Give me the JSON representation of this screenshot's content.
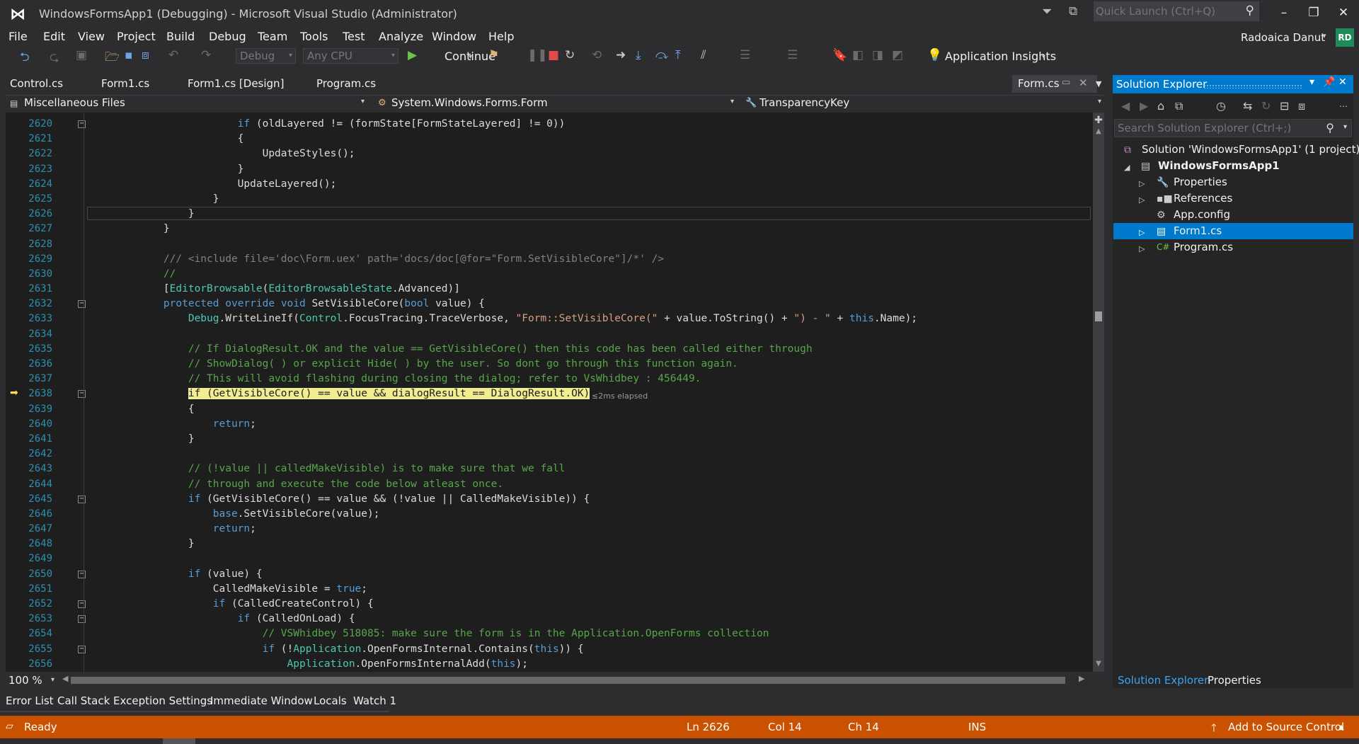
{
  "window": {
    "title": "WindowsFormsApp1 (Debugging) - Microsoft Visual Studio  (Administrator)",
    "quick_launch_placeholder": "Quick Launch (Ctrl+Q)"
  },
  "menu": [
    "File",
    "Edit",
    "View",
    "Project",
    "Build",
    "Debug",
    "Team",
    "Tools",
    "Test",
    "Analyze",
    "Window",
    "Help"
  ],
  "user": {
    "name": "Radoaica Danut",
    "initials": "RD"
  },
  "toolbar": {
    "config": "Debug",
    "platform": "Any CPU",
    "continue": "Continue",
    "app_insights": "Application Insights"
  },
  "doc_tabs": [
    "Control.cs",
    "Form1.cs",
    "Form1.cs [Design]",
    "Program.cs"
  ],
  "active_tab": "Form.cs",
  "navbar": {
    "project": "Miscellaneous Files",
    "type": "System.Windows.Forms.Form",
    "member": "TransparencyKey"
  },
  "editor": {
    "zoom": "100 %",
    "current_line": 2626,
    "execution_line": 2638,
    "elapsed": "≤2ms elapsed",
    "lines": [
      {
        "n": "2620",
        "c": "                if (oldLayered != (formState[FormStateLayered] != 0))"
      },
      {
        "n": "2621",
        "c": "                {"
      },
      {
        "n": "2622",
        "c": "                    UpdateStyles();"
      },
      {
        "n": "2623",
        "c": "                }"
      },
      {
        "n": "2624",
        "c": "                UpdateLayered();"
      },
      {
        "n": "2625",
        "c": "            }"
      },
      {
        "n": "2626",
        "c": "        }"
      },
      {
        "n": "2627",
        "c": "    }"
      },
      {
        "n": "2628",
        "c": ""
      },
      {
        "n": "2629",
        "c": "    /// <include file='doc\\Form.uex' path='docs/doc[@for=\"Form.SetVisibleCore\"]/*' />"
      },
      {
        "n": "2630",
        "c": "    //"
      },
      {
        "n": "2631",
        "c": "    [EditorBrowsable(EditorBrowsableState.Advanced)]"
      },
      {
        "n": "2632",
        "c": "    protected override void SetVisibleCore(bool value) {"
      },
      {
        "n": "2633",
        "c": "        Debug.WriteLineIf(Control.FocusTracing.TraceVerbose, \"Form::SetVisibleCore(\" + value.ToString() + \") - \" + this.Name);"
      },
      {
        "n": "2634",
        "c": ""
      },
      {
        "n": "2635",
        "c": "        // If DialogResult.OK and the value == GetVisibleCore() then this code has been called either through"
      },
      {
        "n": "2636",
        "c": "        // ShowDialog( ) or explicit Hide( ) by the user. So dont go through this function again."
      },
      {
        "n": "2637",
        "c": "        // This will avoid flashing during closing the dialog; refer to VsWhidbey : 456449."
      },
      {
        "n": "2638",
        "c": "        if (GetVisibleCore() == value && dialogResult == DialogResult.OK)"
      },
      {
        "n": "2639",
        "c": "        {"
      },
      {
        "n": "2640",
        "c": "            return;"
      },
      {
        "n": "2641",
        "c": "        }"
      },
      {
        "n": "2642",
        "c": ""
      },
      {
        "n": "2643",
        "c": "        // (!value || calledMakeVisible) is to make sure that we fall"
      },
      {
        "n": "2644",
        "c": "        // through and execute the code below atleast once."
      },
      {
        "n": "2645",
        "c": "        if (GetVisibleCore() == value && (!value || CalledMakeVisible)) {"
      },
      {
        "n": "2646",
        "c": "            base.SetVisibleCore(value);"
      },
      {
        "n": "2647",
        "c": "            return;"
      },
      {
        "n": "2648",
        "c": "        }"
      },
      {
        "n": "2649",
        "c": ""
      },
      {
        "n": "2650",
        "c": "        if (value) {"
      },
      {
        "n": "2651",
        "c": "            CalledMakeVisible = true;"
      },
      {
        "n": "2652",
        "c": "            if (CalledCreateControl) {"
      },
      {
        "n": "2653",
        "c": "                if (CalledOnLoad) {"
      },
      {
        "n": "2654",
        "c": "                    // VSWhidbey 518085: make sure the form is in the Application.OpenForms collection"
      },
      {
        "n": "2655",
        "c": "                    if (!Application.OpenFormsInternal.Contains(this)) {"
      },
      {
        "n": "2656",
        "c": "                        Application.OpenFormsInternalAdd(this);"
      }
    ]
  },
  "bottom_tabs": [
    "Error List",
    "Call Stack",
    "Exception Settings",
    "Immediate Window",
    "Locals",
    "Watch 1"
  ],
  "status": {
    "state": "Ready",
    "ln": "Ln 2626",
    "col": "Col 14",
    "ch": "Ch 14",
    "mode": "INS",
    "source_control": "Add to Source Control"
  },
  "solution_explorer": {
    "title": "Solution Explorer",
    "search_placeholder": "Search Solution Explorer (Ctrl+;)",
    "solution": "Solution 'WindowsFormsApp1' (1 project)",
    "project": "WindowsFormsApp1",
    "items": [
      "Properties",
      "References",
      "App.config",
      "Form1.cs",
      "Program.cs"
    ],
    "selected": "Form1.cs",
    "tabs": [
      "Solution Explorer",
      "Properties"
    ]
  },
  "colors": {
    "accent": "#007acc",
    "status_bar": "#ca5100",
    "editor_bg": "#1e1e1e",
    "highlight": "#f0ee91"
  }
}
